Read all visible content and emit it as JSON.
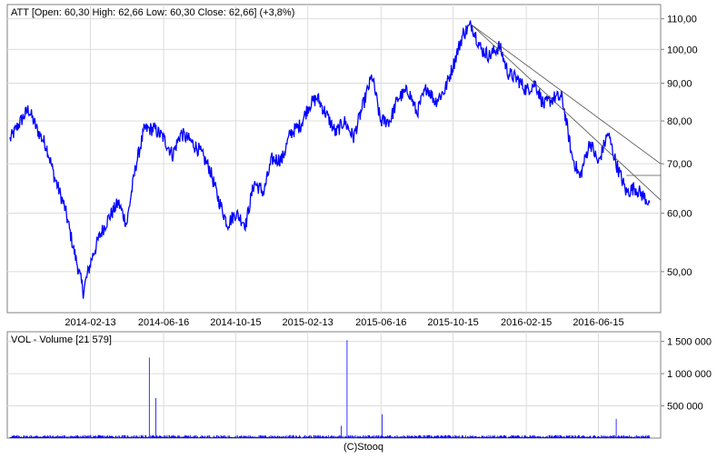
{
  "chart_data": [
    {
      "type": "line",
      "title": "ATT [Open: 60,30  High: 62,66  Low: 60,30  Close: 62,66] (+3,8%)",
      "y_scale": "log",
      "ylim": [
        44,
        115
      ],
      "y_ticks": [
        50,
        60,
        70,
        80,
        90,
        100,
        110
      ],
      "y_tick_labels": [
        "50,00",
        "60,00",
        "70,00",
        "80,00",
        "90,00",
        "100,00",
        "110,00"
      ],
      "x_ticks": [
        "2014-02-13",
        "2014-06-16",
        "2014-10-15",
        "2015-02-13",
        "2015-06-16",
        "2015-10-15",
        "2016-02-15",
        "2016-06-15"
      ],
      "grid": true,
      "series": [
        {
          "color": "#0000ff",
          "x": [
            "2013-10-01",
            "2013-10-15",
            "2013-11-01",
            "2013-11-15",
            "2013-12-01",
            "2013-12-15",
            "2014-01-01",
            "2014-01-15",
            "2014-02-01",
            "2014-02-15",
            "2014-03-01",
            "2014-03-15",
            "2014-04-01",
            "2014-04-15",
            "2014-05-01",
            "2014-05-15",
            "2014-06-01",
            "2014-06-15",
            "2014-07-01",
            "2014-07-15",
            "2014-08-01",
            "2014-08-15",
            "2014-09-01",
            "2014-09-15",
            "2014-10-01",
            "2014-10-15",
            "2014-11-01",
            "2014-11-15",
            "2014-12-01",
            "2014-12-15",
            "2015-01-01",
            "2015-01-15",
            "2015-02-01",
            "2015-02-15",
            "2015-03-01",
            "2015-03-15",
            "2015-04-01",
            "2015-04-15",
            "2015-05-01",
            "2015-05-15",
            "2015-06-01",
            "2015-06-15",
            "2015-07-01",
            "2015-07-15",
            "2015-08-01",
            "2015-08-15",
            "2015-09-01",
            "2015-09-15",
            "2015-10-01",
            "2015-10-15",
            "2015-11-01",
            "2015-11-15",
            "2015-12-01",
            "2015-12-15",
            "2016-01-01",
            "2016-01-15",
            "2016-02-01",
            "2016-02-15",
            "2016-03-01",
            "2016-03-15",
            "2016-04-01",
            "2016-04-15",
            "2016-05-01",
            "2016-05-15",
            "2016-06-01",
            "2016-06-15",
            "2016-07-01",
            "2016-07-15",
            "2016-08-01",
            "2016-08-15",
            "2016-09-01",
            "2016-09-09"
          ],
          "y": [
            75.5,
            79,
            83,
            78,
            74,
            67,
            61,
            54,
            47,
            52,
            56,
            59,
            62,
            58,
            70,
            78,
            78,
            76,
            72,
            77,
            75,
            73,
            69,
            63,
            58,
            60,
            58,
            66,
            64,
            71,
            71,
            77,
            79,
            84,
            86,
            82,
            77,
            80,
            76,
            83,
            92,
            80,
            80,
            86,
            88,
            82,
            89,
            85,
            88,
            95,
            105,
            108,
            100,
            98,
            101,
            93,
            91,
            88,
            90,
            84,
            86,
            86,
            72,
            67,
            75,
            70,
            77,
            70,
            64,
            65,
            63,
            62
          ]
        }
      ]
    },
    {
      "type": "bar",
      "title": "VOL - Volume [21 579]",
      "ylim": [
        0,
        1650000
      ],
      "y_ticks": [
        500000,
        1000000,
        1500000
      ],
      "y_tick_labels": [
        "500 000",
        "1 000 000",
        "1 500 000"
      ],
      "x_ticks": [
        "2014-02-13",
        "2014-06-16",
        "2014-10-15",
        "2015-02-13",
        "2015-06-16",
        "2015-10-15",
        "2016-02-15",
        "2016-06-15"
      ],
      "grid": true,
      "baseline_volume": 25000,
      "spikes": [
        {
          "x": "2014-05-23",
          "value": 1250000
        },
        {
          "x": "2014-06-03",
          "value": 620000
        },
        {
          "x": "2015-04-20",
          "value": 1520000
        },
        {
          "x": "2015-04-10",
          "value": 190000
        },
        {
          "x": "2015-06-18",
          "value": 370000
        },
        {
          "x": "2016-07-15",
          "value": 300000
        }
      ]
    }
  ],
  "footer": "(C)Stooq"
}
